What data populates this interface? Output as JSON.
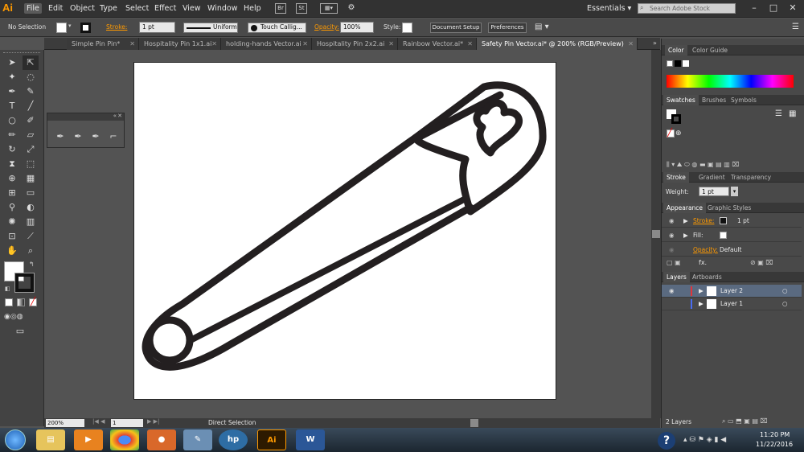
{
  "app": {
    "logo": "Ai"
  },
  "menu": [
    "File",
    "Edit",
    "Object",
    "Type",
    "Select",
    "Effect",
    "View",
    "Window",
    "Help"
  ],
  "menubar_boxes": {
    "bridge": "Br",
    "stock": "St"
  },
  "workspace": "Essentials ▾",
  "search": {
    "placeholder": "Search Adobe Stock"
  },
  "window_controls": {
    "min": "–",
    "max": "□",
    "close": "✕"
  },
  "control": {
    "selection": "No Selection",
    "stroke_label": "Stroke:",
    "stroke_value": "1 pt",
    "profile": "Uniform",
    "brush": "Touch Callig...",
    "opacity_label": "Opacity:",
    "opacity_value": "100%",
    "style_label": "Style:",
    "doc_setup": "Document Setup",
    "preferences": "Preferences"
  },
  "tabs": [
    {
      "label": "Simple Pin Pin*",
      "active": false
    },
    {
      "label": "Hospitality Pin 1x1.ai",
      "active": false
    },
    {
      "label": "holding-hands Vector.ai",
      "active": false
    },
    {
      "label": "Hospitality Pin 2x2.ai",
      "active": false
    },
    {
      "label": "Rainbow Vector.ai*",
      "active": false
    },
    {
      "label": "Safety Pin Vector.ai* @ 200% (RGB/Preview)",
      "active": true
    }
  ],
  "status": {
    "zoom": "200%",
    "artboard": "1",
    "tool": "Direct Selection"
  },
  "panels": {
    "color_tabs": [
      "Color",
      "Color Guide"
    ],
    "swatches_tabs": [
      "Swatches",
      "Brushes",
      "Symbols"
    ],
    "stroke_tabs": [
      "Stroke",
      "Gradient",
      "Transparency"
    ],
    "weight_label": "Weight:",
    "weight_value": "1 pt",
    "appearance_tabs": [
      "Appearance",
      "Graphic Styles"
    ],
    "appearance": {
      "stroke_label": "Stroke:",
      "stroke_value": "1 pt",
      "fill_label": "Fill:",
      "opacity_label": "Opacity:",
      "opacity_value": "Default",
      "fx": "fx."
    },
    "layers_tabs": [
      "Layers",
      "Artboards"
    ],
    "layers": [
      {
        "name": "Layer 2",
        "color": "#e0343a"
      },
      {
        "name": "Layer 1",
        "color": "#4a6cf0"
      }
    ],
    "layers_count": "2 Layers"
  },
  "taskbar": {
    "time": "11:20 PM",
    "date": "11/22/2016",
    "apps": [
      "start",
      "explorer",
      "media",
      "chrome",
      "firefox",
      "paint",
      "hp",
      "illustrator",
      "word"
    ],
    "labels": {
      "ai": "Ai",
      "word": "W",
      "hp": "hp"
    }
  },
  "colors": {
    "accent": "#ff9a00",
    "ai_orange": "#ff9a00",
    "word_blue": "#2b5797"
  }
}
